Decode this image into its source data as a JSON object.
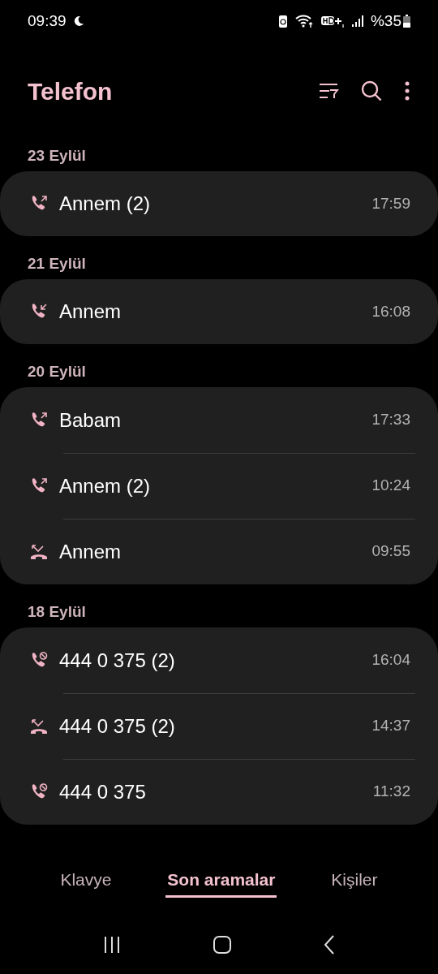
{
  "status_bar": {
    "time": "09:39",
    "battery": "%35"
  },
  "title": "Telefon",
  "sections": [
    {
      "date": "23 Eylül",
      "calls": [
        {
          "name": "Annem (2)",
          "time": "17:59",
          "kind": "outgoing"
        }
      ]
    },
    {
      "date": "21 Eylül",
      "calls": [
        {
          "name": "Annem",
          "time": "16:08",
          "kind": "incoming"
        }
      ]
    },
    {
      "date": "20 Eylül",
      "calls": [
        {
          "name": "Babam",
          "time": "17:33",
          "kind": "outgoing"
        },
        {
          "name": "Annem (2)",
          "time": "10:24",
          "kind": "outgoing"
        },
        {
          "name": "Annem",
          "time": "09:55",
          "kind": "missed"
        }
      ]
    },
    {
      "date": "18 Eylül",
      "calls": [
        {
          "name": "444 0 375 (2)",
          "time": "16:04",
          "kind": "blocked"
        },
        {
          "name": "444 0 375 (2)",
          "time": "14:37",
          "kind": "missed"
        },
        {
          "name": "444 0 375",
          "time": "11:32",
          "kind": "blocked"
        }
      ]
    }
  ],
  "tabs": [
    {
      "label": "Klavye",
      "selected": false
    },
    {
      "label": "Son aramalar",
      "selected": true
    },
    {
      "label": "Kişiler",
      "selected": false
    }
  ]
}
